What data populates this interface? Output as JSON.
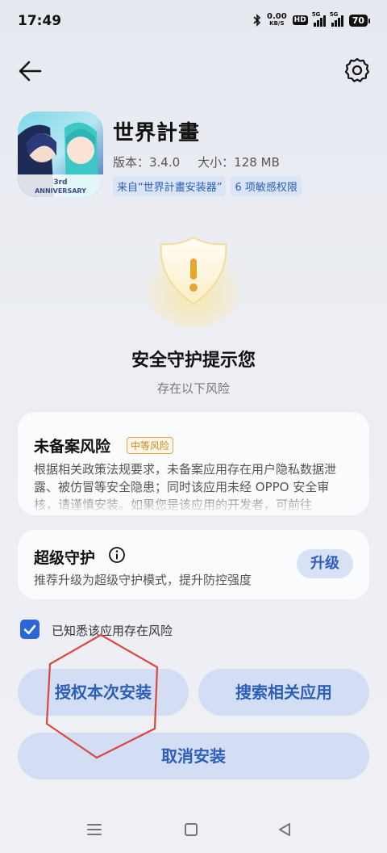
{
  "status_bar": {
    "time": "17:49",
    "net_speed_value": "0.00",
    "net_speed_unit": "KB/S",
    "hd_label": "HD",
    "sim1_label": "5G",
    "sim2_label": "5G",
    "battery": "70"
  },
  "app": {
    "name": "世界計畫",
    "version": "版本：3.4.0",
    "size": "大小：128 MB",
    "source_tag": "来自“世界計畫安装器”",
    "permission_tag": "6 项敏感权限",
    "icon_text": "ANNIVERSARY"
  },
  "warning": {
    "title": "安全守护提示您",
    "subtitle": "存在以下风险"
  },
  "risk_card": {
    "title": "未备案风险",
    "badge": "中等风险",
    "text": "根据相关政策法规要求，未备案应用存在用户隐私数据泄露、被仿冒等安全隐患；同时该应用未经 OPPO 安全审核，请谨慎安装。如果您是该应用的开发者，可前往"
  },
  "guard_card": {
    "title": "超级守护",
    "description": "推荐升级为超级守护模式，提升防控强度",
    "upgrade_label": "升级"
  },
  "acknowledge": {
    "label": "已知悉该应用存在风险",
    "checked": true
  },
  "actions": {
    "authorize_label": "授权本次安装",
    "search_label": "搜索相关应用",
    "cancel_label": "取消安装"
  },
  "colors": {
    "accent": "#2b66d9",
    "button_bg": "#d3ddf3",
    "warning": "#c58a1e",
    "annotation": "#d9473f"
  },
  "icons": {
    "back": "arrow-left-icon",
    "settings": "gear-icon",
    "info": "info-icon",
    "nav_menu": "menu-icon",
    "nav_home": "home-icon",
    "nav_back": "triangle-back-icon"
  }
}
